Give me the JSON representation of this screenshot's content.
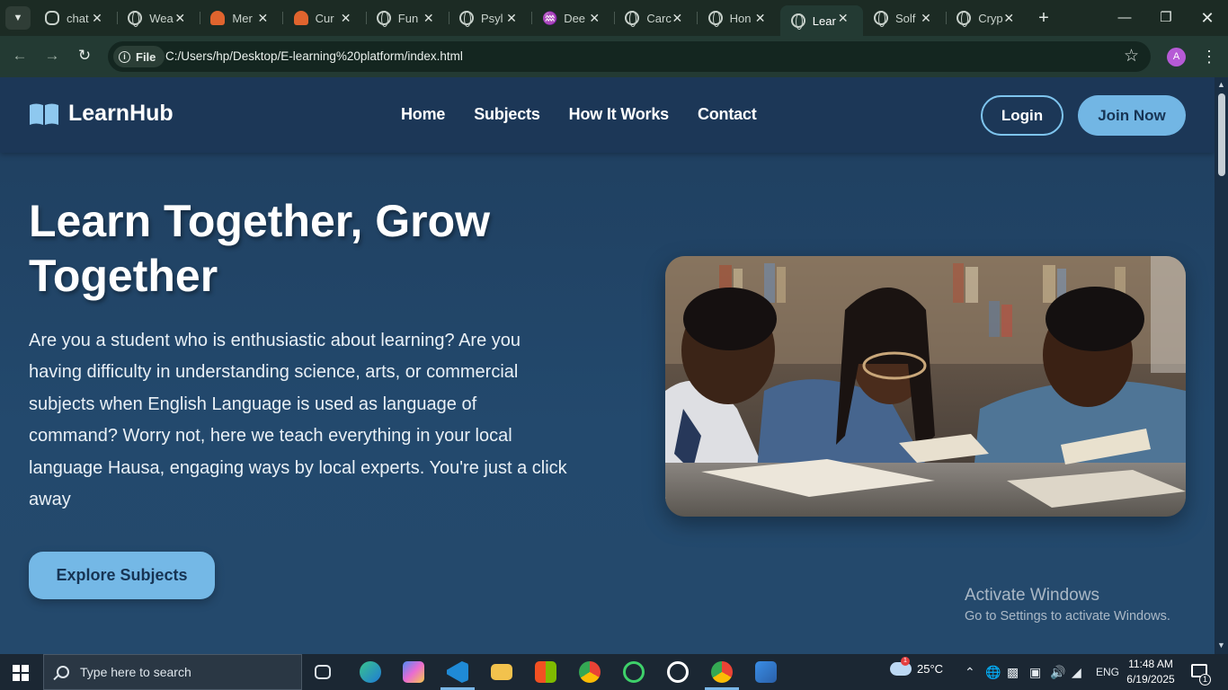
{
  "browser": {
    "tabs": [
      {
        "label": "chat",
        "icon": "openai-icon"
      },
      {
        "label": "Wea",
        "icon": "globe-icon"
      },
      {
        "label": "Mer",
        "icon": "helmet-icon"
      },
      {
        "label": "Cur",
        "icon": "helmet-icon"
      },
      {
        "label": "Fun",
        "icon": "globe-icon"
      },
      {
        "label": "Psyl",
        "icon": "globe-icon"
      },
      {
        "label": "Dee",
        "icon": "deepseek-icon"
      },
      {
        "label": "Carc",
        "icon": "globe-icon"
      },
      {
        "label": "Hon",
        "icon": "globe-icon"
      },
      {
        "label": "Lear",
        "icon": "globe-icon",
        "active": true
      },
      {
        "label": "Solf",
        "icon": "globe-icon"
      },
      {
        "label": "Cryp",
        "icon": "globe-icon"
      }
    ],
    "file_chip": "File",
    "url": "C:/Users/hp/Desktop/E-learning%20platform/index.html",
    "profile_initial": "A"
  },
  "site": {
    "logo_text": "LearnHub",
    "nav": [
      "Home",
      "Subjects",
      "How It Works",
      "Contact"
    ],
    "login_label": "Login",
    "join_label": "Join Now",
    "hero_title": "Learn Together, Grow Together",
    "hero_text": "Are you a student who is enthusiastic about learning? Are you having difficulty in understanding science, arts, or commercial subjects when English Language is used as language of command? Worry not, here we teach everything in your local language Hausa, engaging ways by local experts. You're just a click away",
    "explore_label": "Explore Subjects",
    "colors": {
      "accent": "#72b6e4",
      "header_bg": "#1c3757",
      "page_bg": "#23496d"
    }
  },
  "watermark": {
    "line1": "Activate Windows",
    "line2": "Go to Settings to activate Windows."
  },
  "taskbar": {
    "search_placeholder": "Type here to search",
    "weather_temp": "25°C",
    "weather_badge": "1",
    "language": "ENG",
    "time": "11:48 AM",
    "date": "6/19/2025",
    "notifications": "1"
  }
}
